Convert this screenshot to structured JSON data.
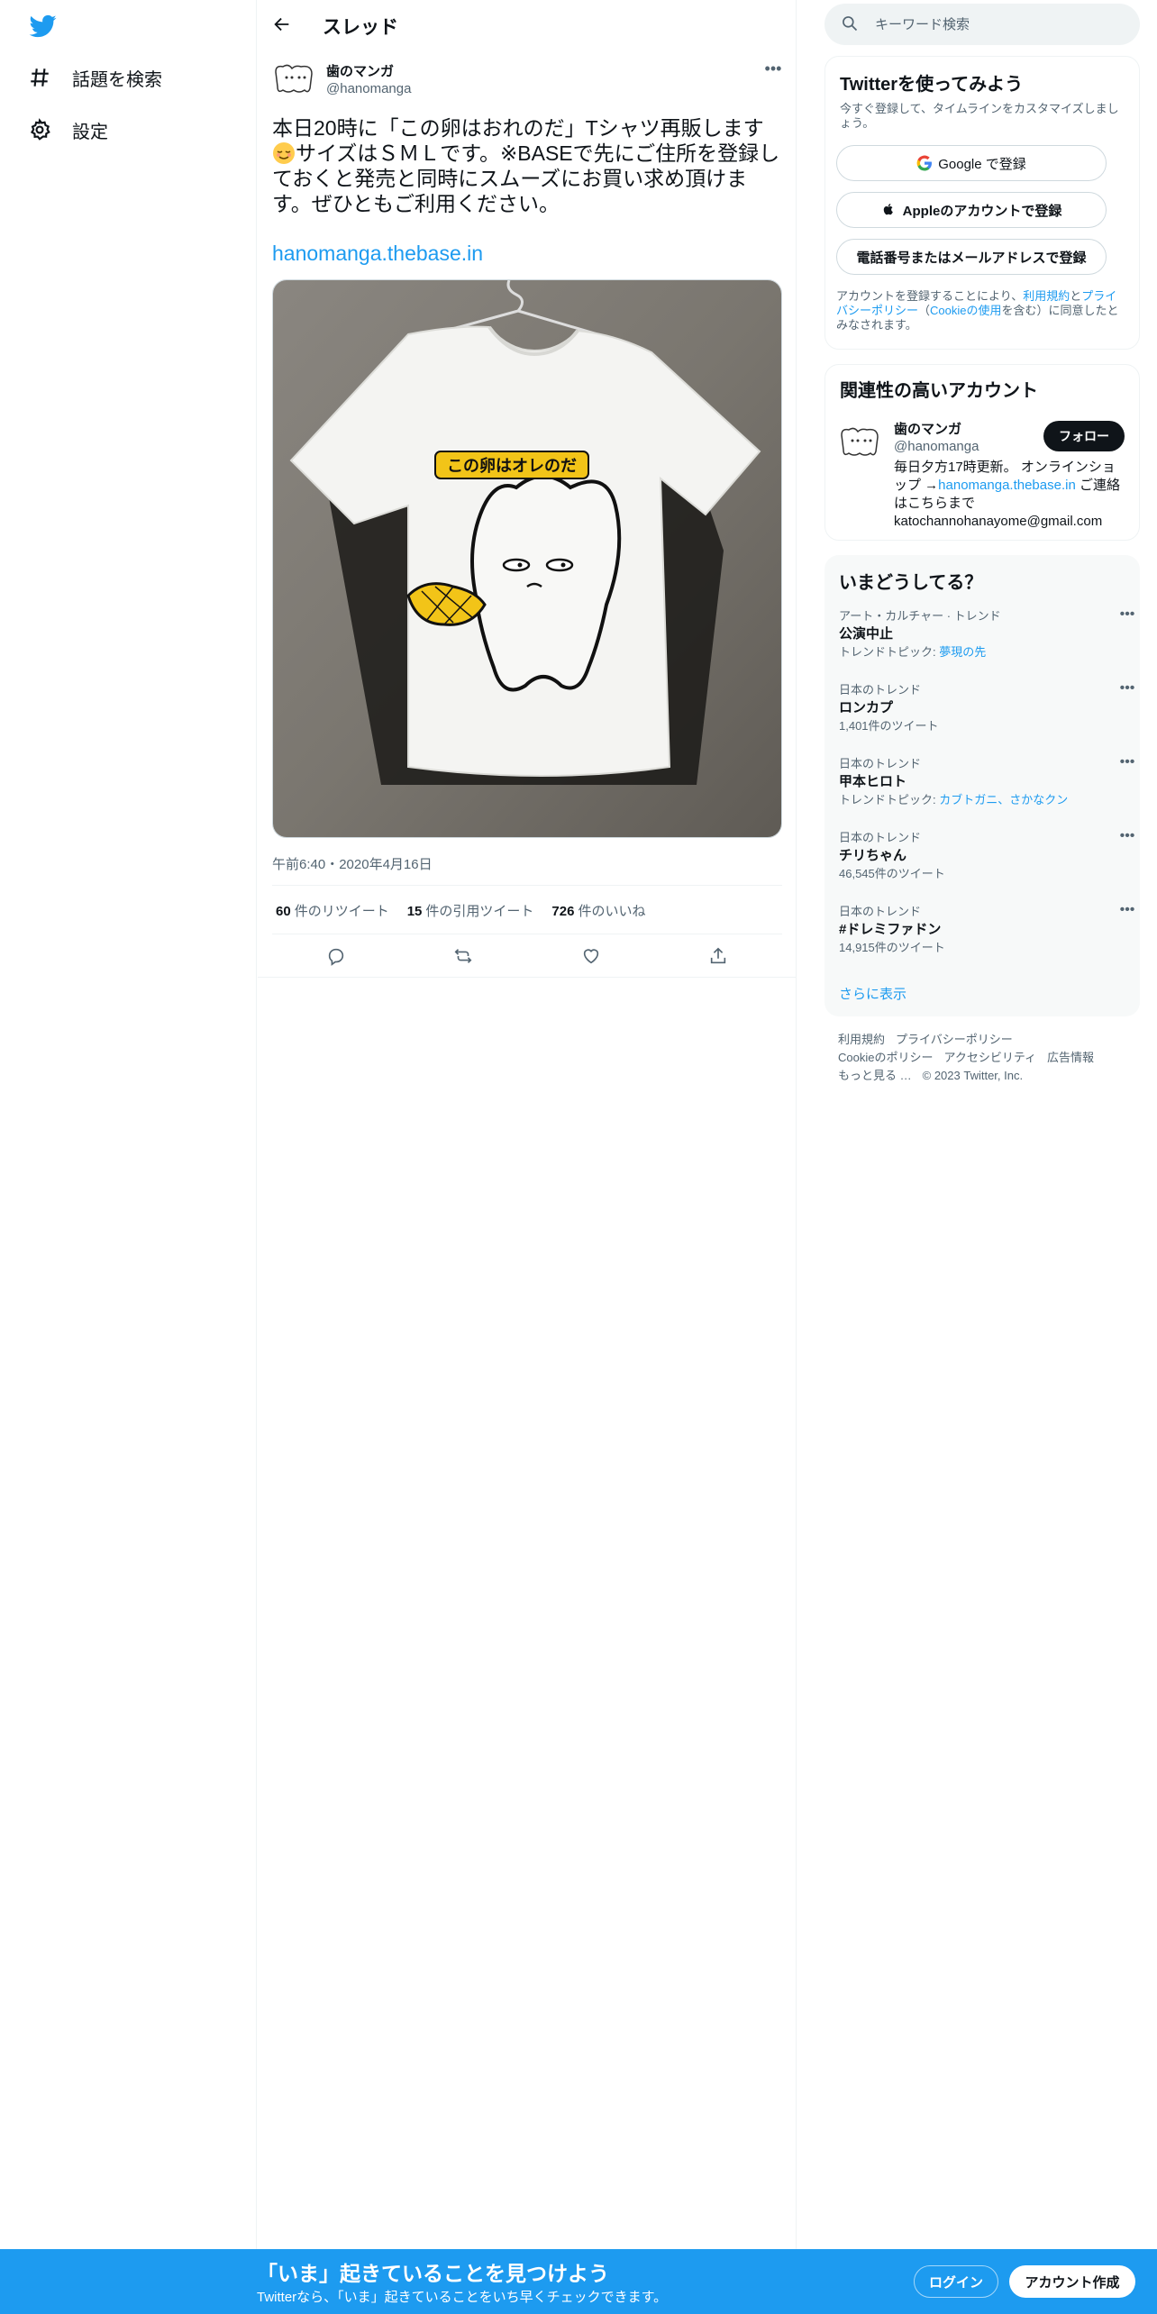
{
  "colors": {
    "accent": "#1d9bf0",
    "text": "#0f1419",
    "muted": "#536471",
    "banner": "#1d9bf0"
  },
  "sidebar": {
    "logo_icon": "twitter-bird-icon",
    "items": [
      {
        "icon": "hashtag-icon",
        "label": "話題を検索"
      },
      {
        "icon": "gear-icon",
        "label": "設定"
      }
    ]
  },
  "header": {
    "back_icon": "arrow-left-icon",
    "title": "スレッド"
  },
  "tweet": {
    "author_name": "歯のマンガ",
    "author_handle": "@hanomanga",
    "text_part1": "本日20時に「この卵はおれのだ」Tシャツ再販します",
    "emoji": "relieved-face-emoji",
    "text_part2": "サイズはＳＭＬです。※BASEで先にご住所を登録しておくと発売と同時にスムーズにお買い求め頂けます。ぜひともご利用ください。",
    "link": "hanomanga.thebase.in",
    "image_text": "この卵はオレのだ",
    "timestamp": "午前6:40・2020年4月16日",
    "retweets": {
      "count": "60",
      "label": "件のリツイート"
    },
    "quotes": {
      "count": "15",
      "label": "件の引用ツイート"
    },
    "likes": {
      "count": "726",
      "label": "件のいいね"
    }
  },
  "search": {
    "placeholder": "キーワード検索"
  },
  "signup_card": {
    "title": "Twitterを使ってみよう",
    "subtitle": "今すぐ登録して、タイムラインをカスタマイズしましょう。",
    "google_label": "Google で登録",
    "apple_label": "Appleのアカウントで登録",
    "phone_label": "電話番号またはメールアドレスで登録",
    "legal_pre": "アカウントを登録することにより、",
    "legal_terms": "利用規約",
    "legal_and": "と",
    "legal_privacy": "プライバシーポリシー",
    "legal_paren_open": "（",
    "legal_cookie": "Cookieの使用",
    "legal_post": "を含む）に同意したとみなされます。"
  },
  "related_card": {
    "title": "関連性の高いアカウント",
    "name": "歯のマンガ",
    "handle": "@hanomanga",
    "follow_label": "フォロー",
    "bio_pre": "毎日夕方17時更新。 オンラインショップ →",
    "bio_link": "hanomanga.thebase.in",
    "bio_post": " ご連絡はこちらまで katochannohanayome@gmail.com"
  },
  "trends_card": {
    "title": "いまどうしてる？",
    "items": [
      {
        "context": "アート・カルチャー · トレンド",
        "name": "公演中止",
        "meta_label": "トレンドトピック: ",
        "meta_link": "夢現の先",
        "meta": ""
      },
      {
        "context": "日本のトレンド",
        "name": "ロンカプ",
        "meta_label": "",
        "meta_link": "",
        "meta": "1,401件のツイート"
      },
      {
        "context": "日本のトレンド",
        "name": "甲本ヒロト",
        "meta_label": "トレンドトピック: ",
        "meta_link": "カブトガニ、さかなクン",
        "meta": ""
      },
      {
        "context": "日本のトレンド",
        "name": "チリちゃん",
        "meta_label": "",
        "meta_link": "",
        "meta": "46,545件のツイート"
      },
      {
        "context": "日本のトレンド",
        "name": "#ドレミファドン",
        "meta_label": "",
        "meta_link": "",
        "meta": "14,915件のツイート"
      }
    ],
    "show_more": "さらに表示"
  },
  "footer": {
    "links": [
      "利用規約",
      "プライバシーポリシー",
      "Cookieのポリシー",
      "アクセシビリティ",
      "広告情報",
      "もっと見る …"
    ],
    "copyright": "© 2023 Twitter, Inc."
  },
  "banner": {
    "title": "「いま」起きていることを見つけよう",
    "subtitle": "Twitterなら、「いま」起きていることをいち早くチェックできます。",
    "login_label": "ログイン",
    "signup_label": "アカウント作成"
  }
}
